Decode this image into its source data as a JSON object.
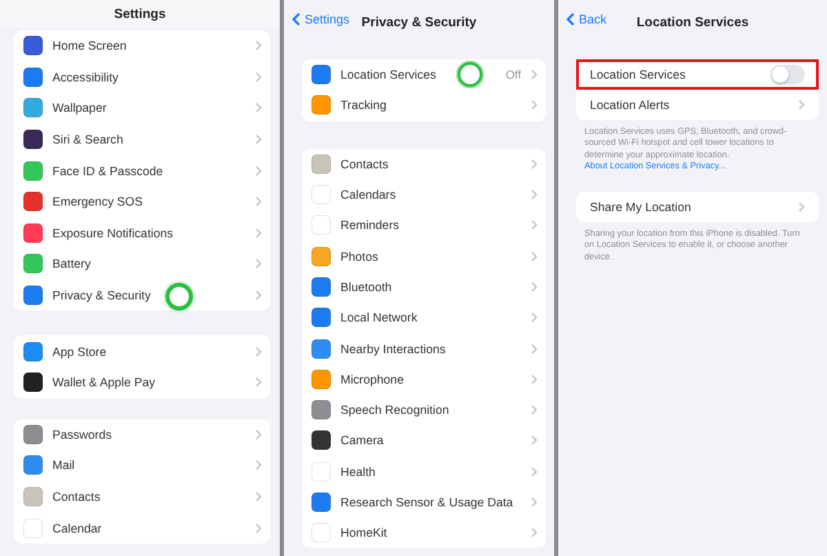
{
  "panels": [
    {
      "kind": "list",
      "title": "Settings",
      "groups": [
        [
          {
            "label": "Home Screen",
            "color": "#3a5bd9",
            "tapped": false
          },
          {
            "label": "Accessibility",
            "color": "#1d7bf0",
            "tapped": false
          },
          {
            "label": "Wallpaper",
            "color": "#35aadc",
            "tapped": false
          },
          {
            "label": "Siri & Search",
            "color": "#3a2a5a",
            "tapped": false
          },
          {
            "label": "Face ID & Passcode",
            "color": "#34c759",
            "tapped": false
          },
          {
            "label": "Emergency SOS",
            "color": "#e5322d",
            "tapped": false
          },
          {
            "label": "Exposure Notifications",
            "color": "#ff3b55",
            "tapped": false
          },
          {
            "label": "Battery",
            "color": "#34c759",
            "tapped": false
          },
          {
            "label": "Privacy & Security",
            "color": "#1d7bf0",
            "tapped": true
          }
        ],
        [
          {
            "label": "App Store",
            "color": "#1d8cf0",
            "tapped": false
          },
          {
            "label": "Wallet & Apple Pay",
            "color": "#222222",
            "tapped": false
          }
        ],
        [
          {
            "label": "Passwords",
            "color": "#8e8e93",
            "tapped": false
          },
          {
            "label": "Mail",
            "color": "#2f8cf0",
            "tapped": false
          },
          {
            "label": "Contacts",
            "color": "#c9c4b8",
            "tapped": false
          },
          {
            "label": "Calendar",
            "color": "#ffffff",
            "tapped": false
          }
        ]
      ]
    },
    {
      "kind": "list",
      "back": "Settings",
      "title": "Privacy & Security",
      "groups": [
        [
          {
            "label": "Location Services",
            "color": "#1d7bf0",
            "value": "Off",
            "tapped": true
          },
          {
            "label": "Tracking",
            "color": "#ff9500",
            "tapped": false
          }
        ],
        [
          {
            "label": "Contacts",
            "color": "#c9c4b8",
            "tapped": false
          },
          {
            "label": "Calendars",
            "color": "#ffffff",
            "tapped": false
          },
          {
            "label": "Reminders",
            "color": "#ffffff",
            "tapped": false
          },
          {
            "label": "Photos",
            "color": "#f5a623",
            "tapped": false
          },
          {
            "label": "Bluetooth",
            "color": "#1d7bf0",
            "tapped": false
          },
          {
            "label": "Local Network",
            "color": "#1d7bf0",
            "tapped": false
          },
          {
            "label": "Nearby Interactions",
            "color": "#2f8cf0",
            "tapped": false
          },
          {
            "label": "Microphone",
            "color": "#ff9500",
            "tapped": false
          },
          {
            "label": "Speech Recognition",
            "color": "#8e8e93",
            "tapped": false
          },
          {
            "label": "Camera",
            "color": "#333333",
            "tapped": false
          },
          {
            "label": "Health",
            "color": "#ffffff",
            "tapped": false
          },
          {
            "label": "Research Sensor & Usage Data",
            "color": "#1d7bf0",
            "tapped": false
          },
          {
            "label": "HomeKit",
            "color": "#ffffff",
            "tapped": false
          }
        ]
      ]
    },
    {
      "kind": "detail",
      "back": "Back",
      "title": "Location Services",
      "groups": [
        {
          "rows": [
            {
              "kind": "toggle",
              "label": "Location Services",
              "on": false,
              "highlighted": true
            },
            {
              "kind": "link",
              "label": "Location Alerts",
              "highlighted": false
            }
          ],
          "footnote": "Location Services uses GPS, Bluetooth, and crowd-sourced Wi-Fi hotspot and cell tower locations to determine your approximate location.",
          "footnote_link": "About Location Services & Privacy..."
        },
        {
          "rows": [
            {
              "kind": "link",
              "label": "Share My Location",
              "highlighted": false
            }
          ],
          "footnote": "Sharing your location from this iPhone is disabled. Turn on Location Services to enable it, or choose another device."
        }
      ]
    }
  ]
}
